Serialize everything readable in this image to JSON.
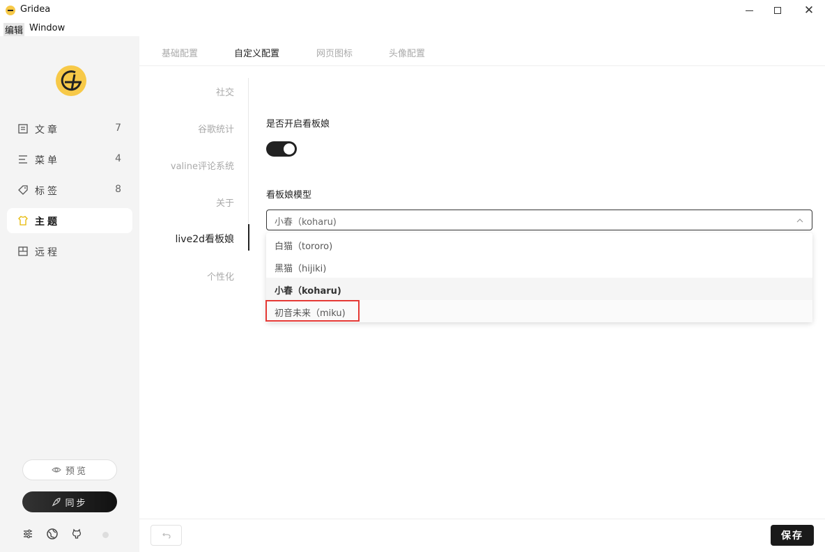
{
  "window": {
    "title": "Gridea"
  },
  "menubar": {
    "edit": "编辑",
    "window": "Window"
  },
  "sidebar": {
    "items": [
      {
        "label": "文章",
        "count": "7",
        "icon": "article-icon"
      },
      {
        "label": "菜单",
        "count": "4",
        "icon": "menu-icon"
      },
      {
        "label": "标签",
        "count": "8",
        "icon": "tag-icon"
      },
      {
        "label": "主题",
        "count": "",
        "icon": "theme-icon"
      },
      {
        "label": "远程",
        "count": "",
        "icon": "remote-icon"
      }
    ],
    "preview_label": "预览",
    "sync_label": "同步"
  },
  "tabs": [
    "基础配置",
    "自定义配置",
    "网页图标",
    "头像配置"
  ],
  "subnav": [
    "社交",
    "谷歌统计",
    "valine评论系统",
    "关于",
    "live2d看板娘",
    "个性化"
  ],
  "form": {
    "toggle_label": "是否开启看板娘",
    "toggle_on": true,
    "model_label": "看板娘模型",
    "model_value": "小春（koharu)",
    "options": [
      "白猫（tororo)",
      "黑猫（hijiki)",
      "小春（koharu)",
      "初音未来（miku)"
    ]
  },
  "bottom": {
    "save_label": "保存"
  },
  "colors": {
    "accent": "#1a1a1a",
    "logo": "#f7c948",
    "highlight": "#e53935"
  }
}
